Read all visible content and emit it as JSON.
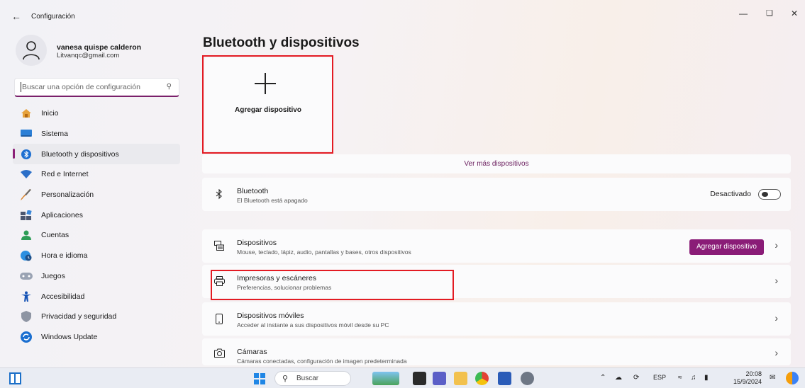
{
  "window": {
    "title": "Configuración",
    "back_icon": "arrow-left-icon",
    "controls": [
      "minimize-icon",
      "restore-icon",
      "close-icon"
    ]
  },
  "profile": {
    "name": "vanesa quispe calderon",
    "email": "Litvanqc@gmail.com"
  },
  "search": {
    "placeholder": "Buscar una opción de configuración",
    "icon": "search-icon"
  },
  "sidebar": {
    "items": [
      {
        "label": "Inicio",
        "icon": "home-icon",
        "active": false
      },
      {
        "label": "Sistema",
        "icon": "monitor-icon",
        "active": false
      },
      {
        "label": "Bluetooth y dispositivos",
        "icon": "bluetooth-icon",
        "active": true
      },
      {
        "label": "Red e Internet",
        "icon": "wifi-icon",
        "active": false
      },
      {
        "label": "Personalización",
        "icon": "brush-icon",
        "active": false
      },
      {
        "label": "Aplicaciones",
        "icon": "apps-icon",
        "active": false
      },
      {
        "label": "Cuentas",
        "icon": "person-icon",
        "active": false
      },
      {
        "label": "Hora e idioma",
        "icon": "globe-clock-icon",
        "active": false
      },
      {
        "label": "Juegos",
        "icon": "gamepad-icon",
        "active": false
      },
      {
        "label": "Accesibilidad",
        "icon": "accessibility-icon",
        "active": false
      },
      {
        "label": "Privacidad y seguridad",
        "icon": "shield-icon",
        "active": false
      },
      {
        "label": "Windows Update",
        "icon": "update-icon",
        "active": false
      }
    ]
  },
  "main": {
    "title": "Bluetooth y dispositivos",
    "add_device_tile": "Agregar dispositivo",
    "see_more": "Ver más dispositivos",
    "bluetooth": {
      "title": "Bluetooth",
      "subtitle": "El Bluetooth está apagado",
      "toggle_label": "Desactivado",
      "toggle_on": false
    },
    "devices": {
      "title": "Dispositivos",
      "subtitle": "Mouse, teclado, lápiz, audio, pantallas y bases, otros dispositivos",
      "button": "Agregar dispositivo"
    },
    "printers": {
      "title": "Impresoras y escáneres",
      "subtitle": "Preferencias, solucionar problemas"
    },
    "mobile": {
      "title": "Dispositivos móviles",
      "subtitle": "Acceder al instante a sus dispositivos móvil desde su PC"
    },
    "cameras": {
      "title": "Cámaras",
      "subtitle": "Cámaras conectadas, configuración de imagen predeterminada"
    }
  },
  "colors": {
    "accent": "#8a1c77",
    "highlight": "#e31b23"
  },
  "taskbar": {
    "search_label": "Buscar",
    "language": "ESP",
    "time": "20:08",
    "date": "15/9/2024"
  }
}
